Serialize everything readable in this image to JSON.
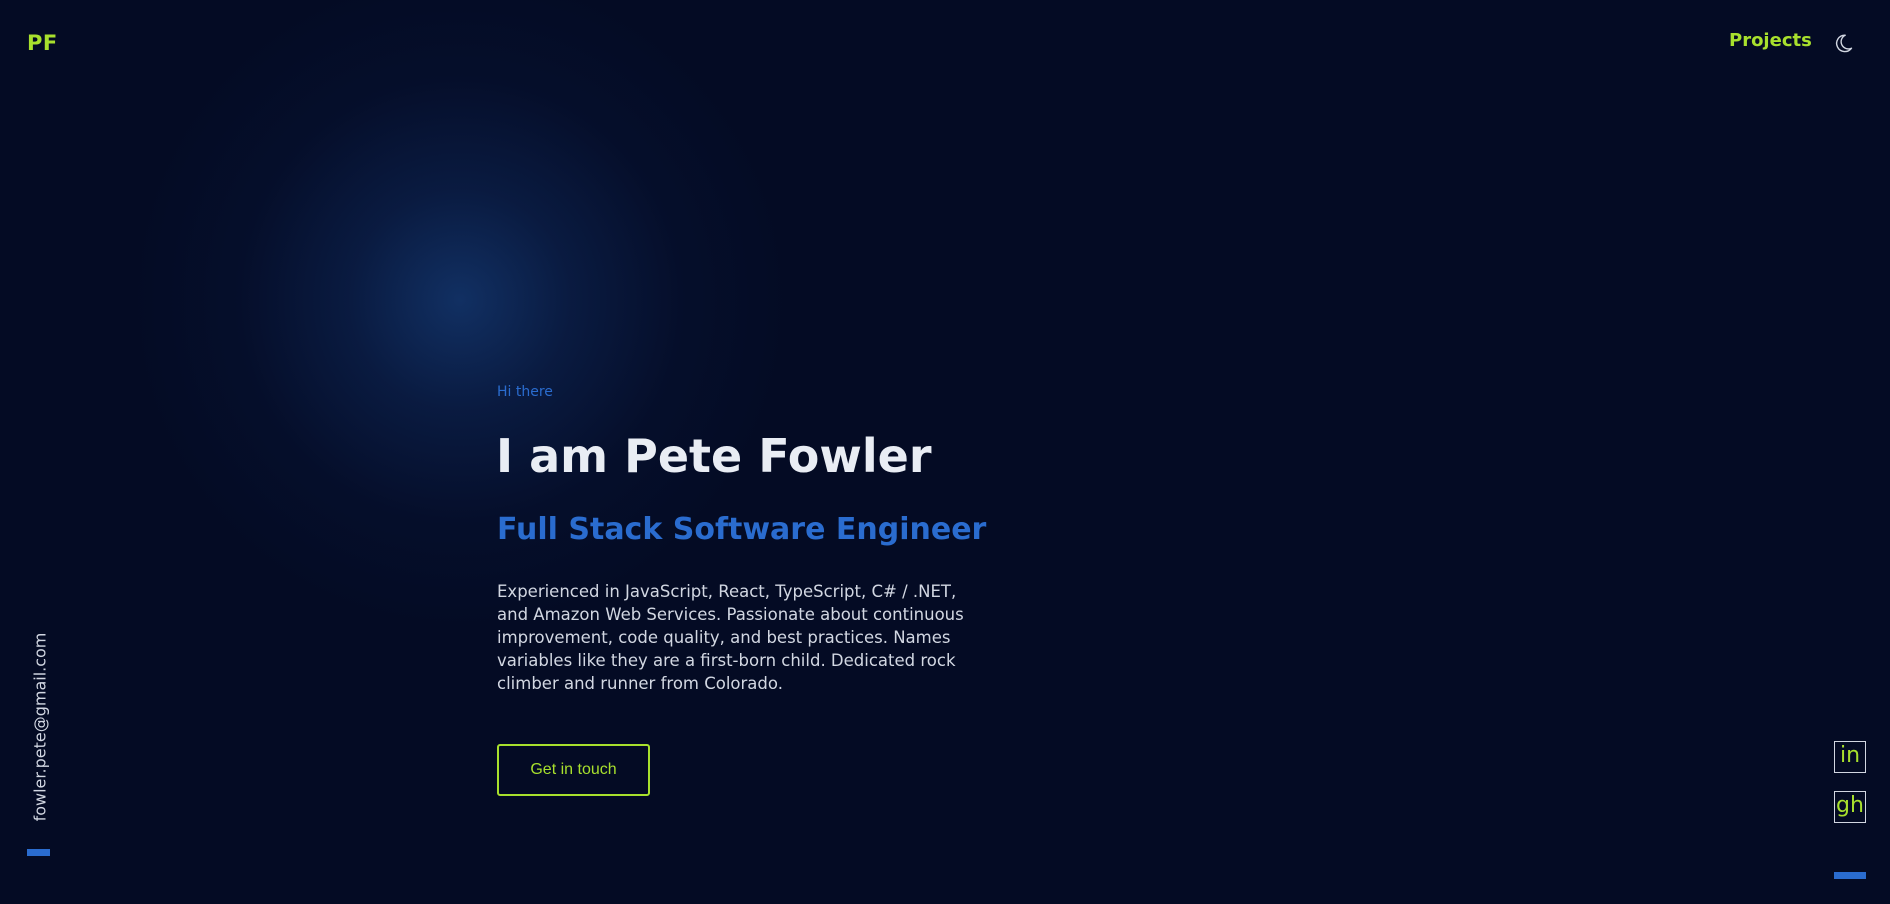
{
  "header": {
    "logo": "PF",
    "nav_projects": "Projects",
    "theme_icon": "moon-icon"
  },
  "hero": {
    "greeting": "Hi there",
    "heading": "I am Pete Fowler",
    "subheading": "Full Stack Software Engineer",
    "bio": "Experienced in JavaScript, React, TypeScript, C# / .NET, and Amazon Web Services. Passionate about continuous improvement, code quality, and best practices. Names variables like they are a first-born child. Dedicated rock climber and runner from Colorado.",
    "cta_label": "Get in touch"
  },
  "sidebar_left": {
    "email": "fowler.pete@gmail.com"
  },
  "sidebar_right": {
    "linkedin_label": "in",
    "github_label": "gh"
  },
  "colors": {
    "background": "#040b24",
    "accent_green": "#a8e02d",
    "accent_blue": "#2a6ccf",
    "text_light": "#d2d7e2"
  }
}
